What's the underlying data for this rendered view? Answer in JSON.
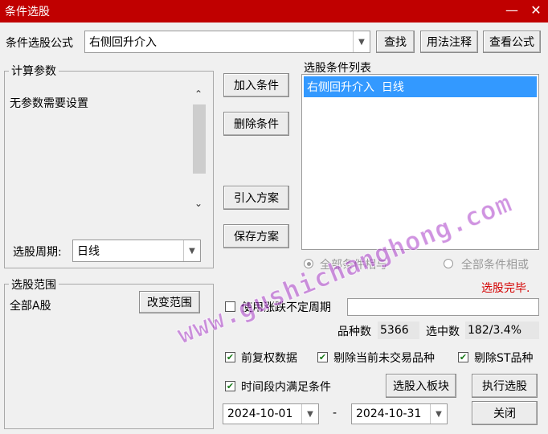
{
  "window": {
    "title": "条件选股",
    "minimize": "—",
    "close": "✕"
  },
  "formula": {
    "label": "条件选股公式",
    "value": "右侧回升介入"
  },
  "toolbar": {
    "find": "查找",
    "usage_notes": "用法注释",
    "view_formula": "查看公式"
  },
  "params": {
    "group_label": "计算参数",
    "text": "无参数需要设置",
    "period_label": "选股周期:",
    "period_value": "日线"
  },
  "middle_buttons": {
    "add": "加入条件",
    "delete": "删除条件",
    "import": "引入方案",
    "save": "保存方案"
  },
  "conditions": {
    "label": "选股条件列表",
    "items": [
      "右侧回升介入  日线"
    ]
  },
  "logic": {
    "and_label": "全部条件相与",
    "or_label": "全部条件相或"
  },
  "status": {
    "text": "选股完毕.",
    "color": "#d40000"
  },
  "scope": {
    "group_label": "选股范围",
    "value": "全部A股",
    "change_button": "改变范围"
  },
  "uncertain_period": {
    "label": "使用涨跌不定周期",
    "checked": false
  },
  "stats": {
    "count_label": "品种数",
    "count_value": "5366",
    "selected_label": "选中数",
    "selected_value": "182/3.4%"
  },
  "options": {
    "forward_adjust": {
      "label": "前复权数据",
      "checked": true
    },
    "exclude_untraded": {
      "label": "剔除当前未交易品种",
      "checked": true
    },
    "exclude_st": {
      "label": "剔除ST品种",
      "checked": true
    },
    "time_range": {
      "label": "时间段内满足条件",
      "checked": true
    }
  },
  "actions": {
    "to_block": "选股入板块",
    "execute": "执行选股",
    "close": "关闭"
  },
  "dates": {
    "start": "2024-10-01",
    "separator": "-",
    "end": "2024-10-31"
  },
  "watermark": "www.gushichanghong.com",
  "colors": {
    "titlebar": "#c00000",
    "selection": "#3399ff",
    "check": "#1a7a1a"
  }
}
